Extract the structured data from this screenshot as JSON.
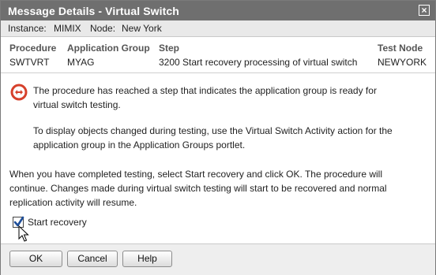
{
  "window": {
    "title": "Message Details - Virtual Switch",
    "close_glyph": "×"
  },
  "instance_bar": {
    "instance_label": "Instance:",
    "instance_value": "MIMIX",
    "node_label": "Node:",
    "node_value": "New York"
  },
  "table": {
    "headers": {
      "procedure": "Procedure",
      "application_group": "Application Group",
      "step": "Step",
      "test_node": "Test Node"
    },
    "row": {
      "procedure": "SWTVRT",
      "application_group": "MYAG",
      "step": "3200 Start recovery processing of virtual switch",
      "test_node": "NEWYORK"
    }
  },
  "message": {
    "icon": "stop-icon",
    "line1": "The procedure has reached a step that indicates the application group is ready for",
    "line2": "virtual switch testing.",
    "line3": "To display objects changed during testing, use the Virtual Switch Activity action for the",
    "line4": "application group in the Application Groups portlet.",
    "line5": "When you have completed testing, select Start recovery and click OK. The procedure will",
    "line6": "continue. Changes made during virtual switch testing will start to be recovered and normal",
    "line7": "replication activity will resume."
  },
  "start_recovery": {
    "label": "Start recovery",
    "checked": true
  },
  "buttons": {
    "ok": "OK",
    "cancel": "Cancel",
    "help": "Help"
  },
  "colors": {
    "titlebar": "#6f6f6f",
    "stop_icon": "#d6402b",
    "checkmark": "#1f4f9a"
  }
}
